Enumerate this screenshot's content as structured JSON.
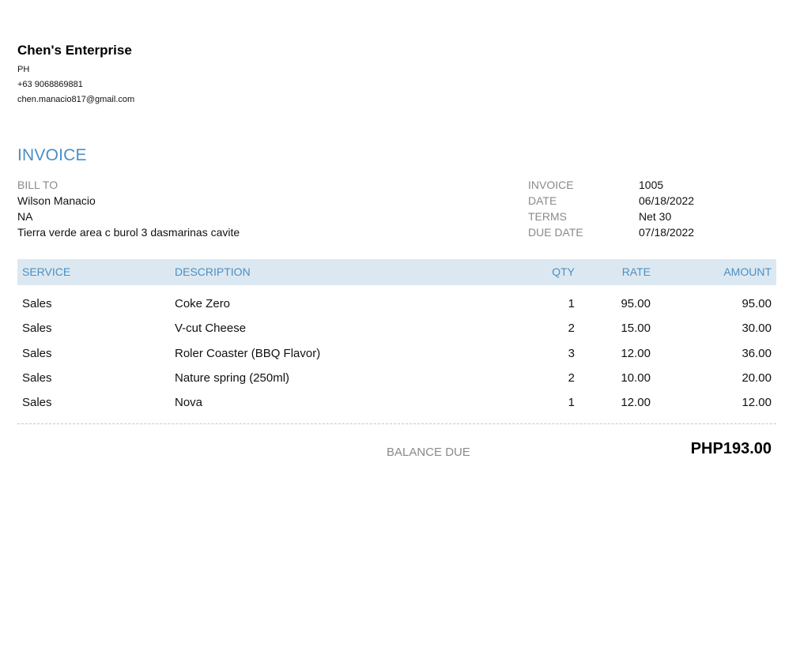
{
  "company": {
    "name": "Chen's Enterprise",
    "country": "PH",
    "phone": "+63 9068869881",
    "email": "chen.manacio817@gmail.com"
  },
  "invoice_title": "INVOICE",
  "bill_to": {
    "label": "BILL TO",
    "name": "Wilson Manacio",
    "line2": "NA",
    "address": "Tierra verde area c burol 3 dasmarinas cavite"
  },
  "meta": [
    {
      "label": "INVOICE",
      "value": "1005"
    },
    {
      "label": "DATE",
      "value": "06/18/2022"
    },
    {
      "label": "TERMS",
      "value": "Net 30"
    },
    {
      "label": "DUE DATE",
      "value": "07/18/2022"
    }
  ],
  "table": {
    "headers": {
      "service": "SERVICE",
      "description": "DESCRIPTION",
      "qty": "QTY",
      "rate": "RATE",
      "amount": "AMOUNT"
    },
    "rows": [
      {
        "service": "Sales",
        "description": "Coke Zero",
        "qty": "1",
        "rate": "95.00",
        "amount": "95.00"
      },
      {
        "service": "Sales",
        "description": "V-cut Cheese",
        "qty": "2",
        "rate": "15.00",
        "amount": "30.00"
      },
      {
        "service": "Sales",
        "description": "Roler Coaster (BBQ Flavor)",
        "qty": "3",
        "rate": "12.00",
        "amount": "36.00"
      },
      {
        "service": "Sales",
        "description": "Nature spring (250ml)",
        "qty": "2",
        "rate": "10.00",
        "amount": "20.00"
      },
      {
        "service": "Sales",
        "description": "Nova",
        "qty": "1",
        "rate": "12.00",
        "amount": "12.00"
      }
    ]
  },
  "balance": {
    "label": "BALANCE DUE",
    "value": "PHP193.00"
  },
  "colors": {
    "accent": "#4a8fc4",
    "header_bg": "#dce8f1",
    "muted": "#8a8a8a"
  }
}
